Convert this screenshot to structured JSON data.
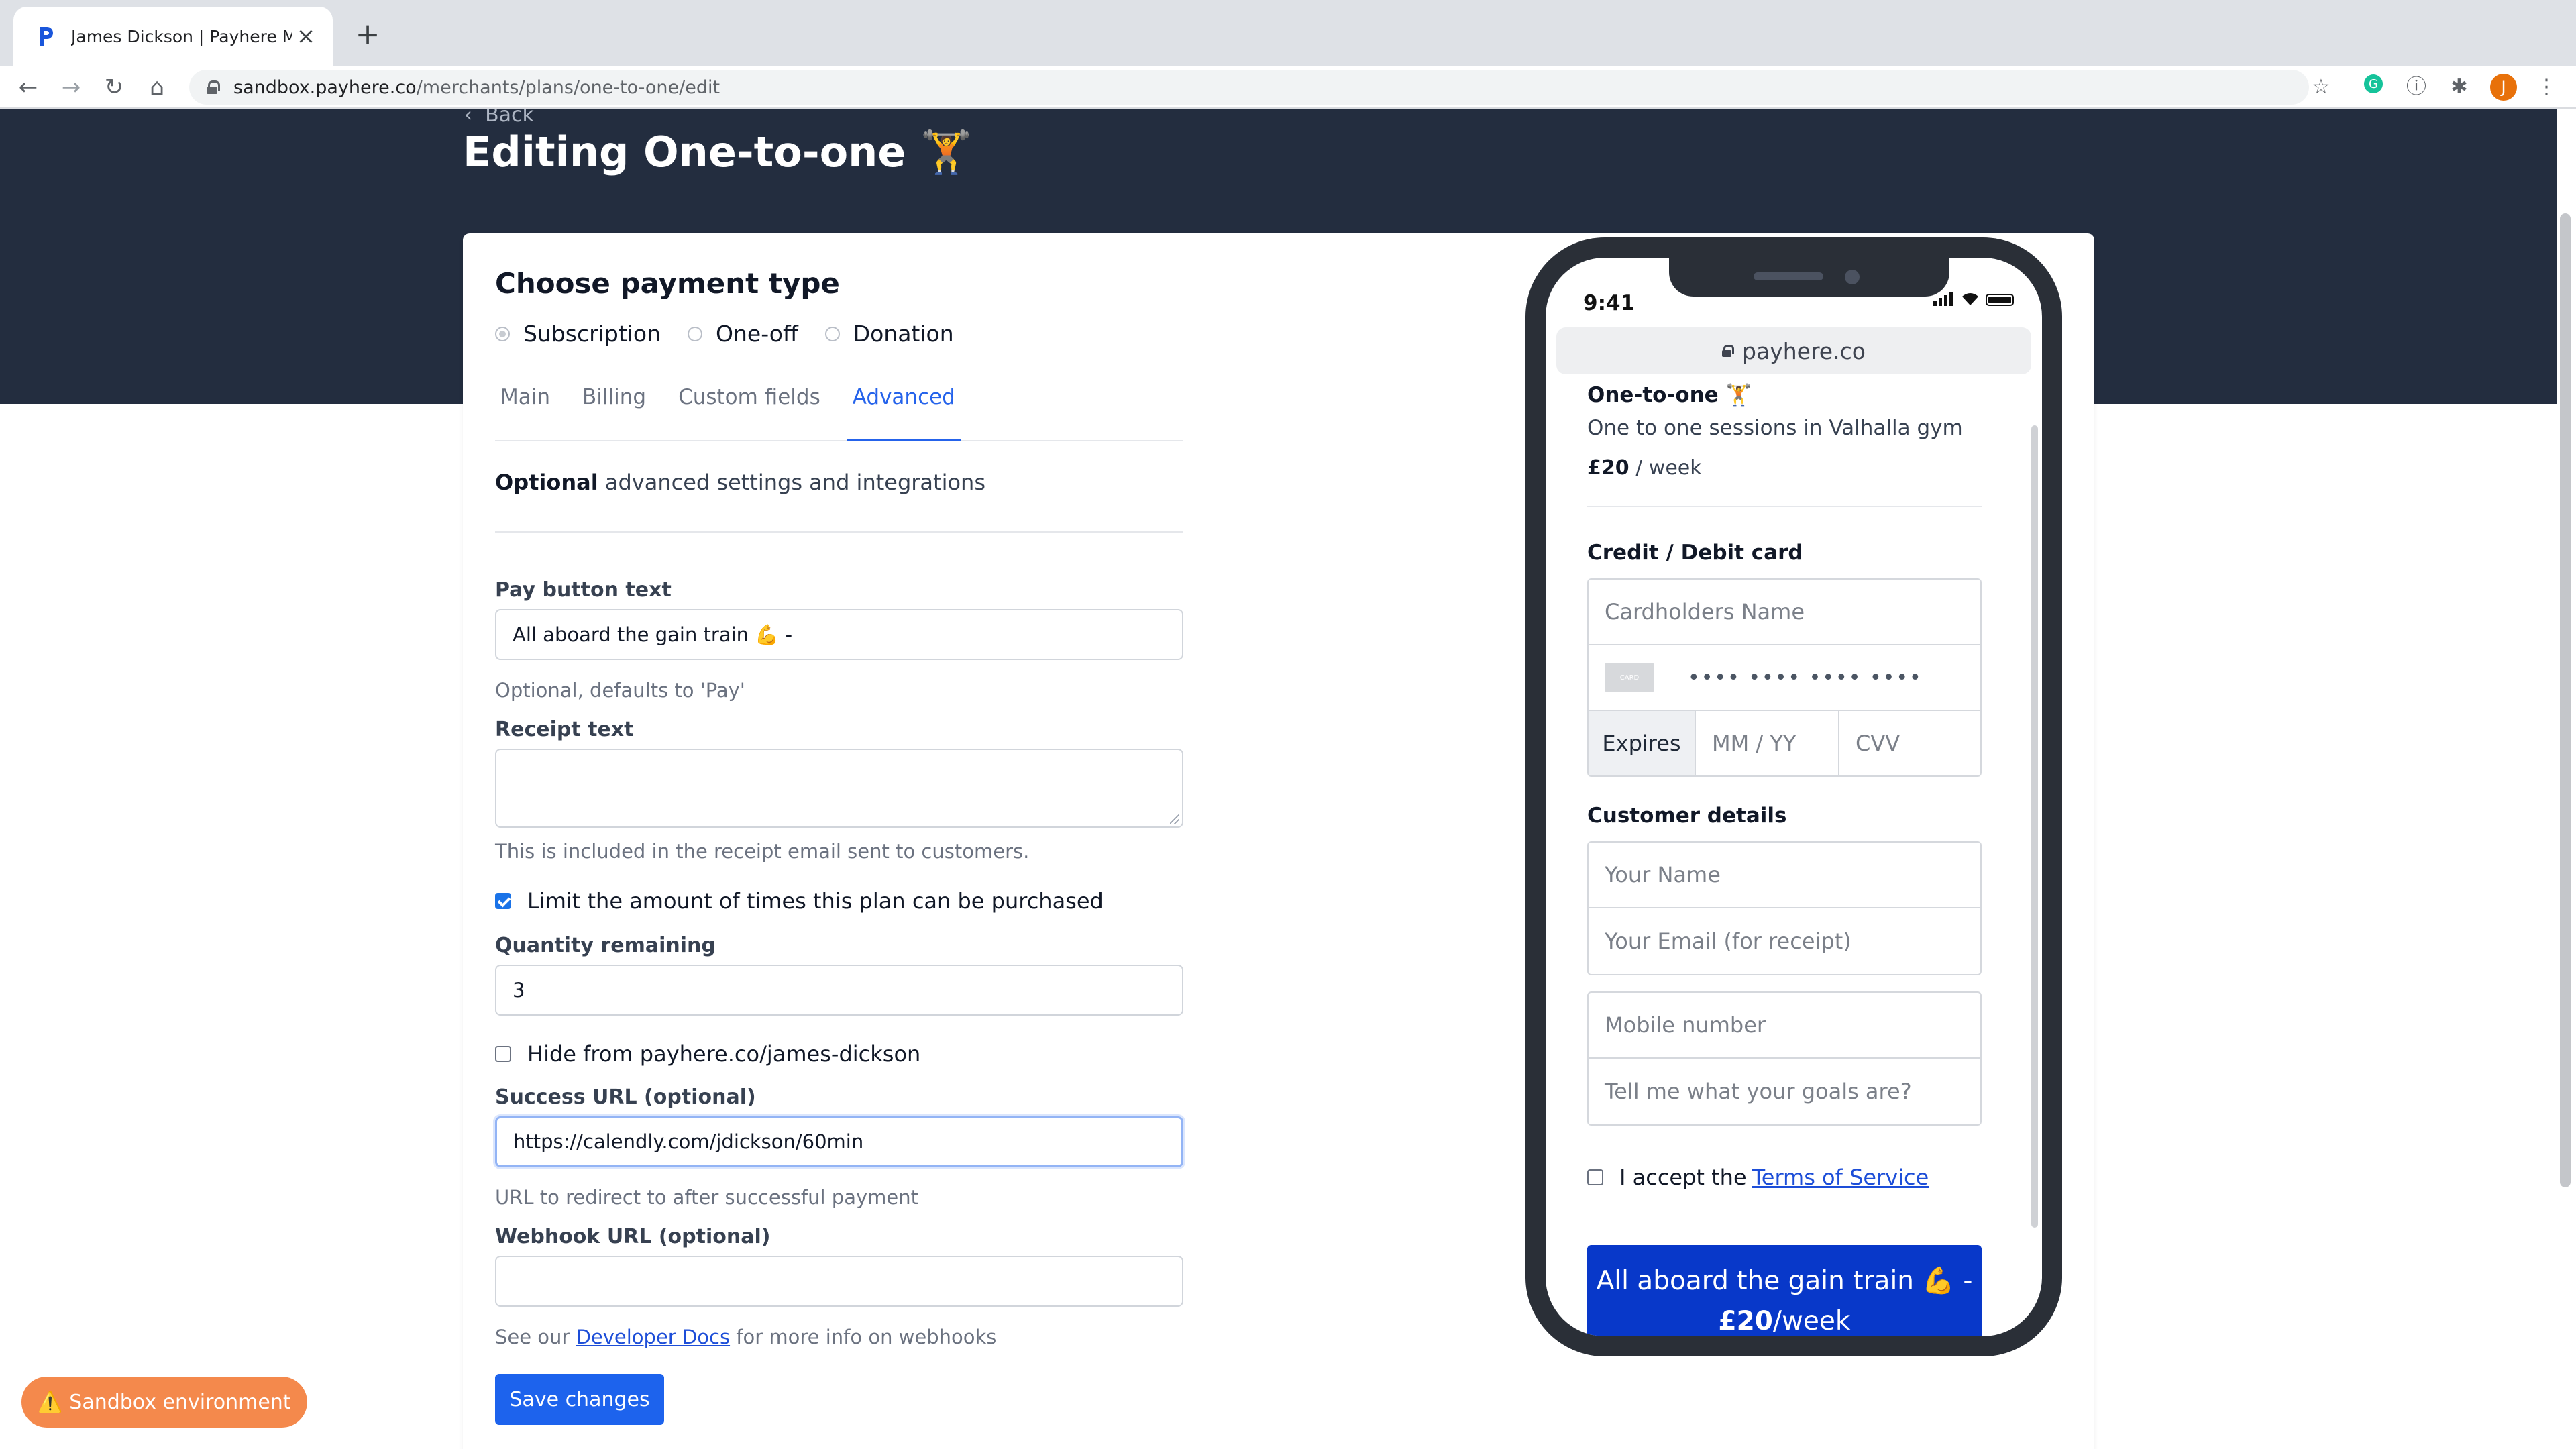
{
  "browser": {
    "tab_title": "James Dickson | Payhere Merc",
    "tab_close": "×",
    "new_tab": "+",
    "url_host": "sandbox.payhere.co",
    "url_path": "/merchants/plans/one-to-one/edit",
    "avatar_letter": "J",
    "favicon_color": "#1a56db"
  },
  "header": {
    "back_label": "Back",
    "title": "Editing One-to-one 🏋"
  },
  "form": {
    "section_title": "Choose payment type",
    "payment_types": [
      "Subscription",
      "One-off",
      "Donation"
    ],
    "selected_payment_type": "Subscription",
    "tabs": [
      "Main",
      "Billing",
      "Custom fields",
      "Advanced"
    ],
    "active_tab": "Advanced",
    "intro_bold": "Optional",
    "intro_rest": " advanced settings and integrations",
    "pay_button_label": "Pay button text",
    "pay_button_value": "All aboard the gain train 💪 -",
    "pay_button_help": "Optional, defaults to 'Pay'",
    "receipt_label": "Receipt text",
    "receipt_value": "",
    "receipt_help": "This is included in the receipt email sent to customers.",
    "limit_label": "Limit the amount of times this plan can be purchased",
    "limit_checked": true,
    "quantity_label": "Quantity remaining",
    "quantity_value": "3",
    "hide_label": "Hide from payhere.co/james-dickson",
    "hide_checked": false,
    "success_url_label": "Success URL (optional)",
    "success_url_value": "https://calendly.com/jdickson/60min",
    "success_url_help": "URL to redirect to after successful payment",
    "webhook_label": "Webhook URL (optional)",
    "webhook_value": "",
    "webhook_help_prefix": "See our ",
    "webhook_help_link": "Developer Docs",
    "webhook_help_suffix": " for more info on webhooks",
    "save_label": "Save changes",
    "accent_color": "#2563eb"
  },
  "preview": {
    "status_time": "9:41",
    "address": "payhere.co",
    "plan_name": "One-to-one 🏋",
    "plan_description": "One to one sessions in Valhalla gym",
    "price_amount": "£20",
    "price_period": " / week",
    "card_heading": "Credit / Debit card",
    "cardholder_placeholder": "Cardholders Name",
    "card_chip_text": "CARD",
    "card_number_placeholder": "•••• •••• •••• ••••",
    "expires_label": "Expires",
    "expiry_placeholder": "MM / YY",
    "cvv_placeholder": "CVV",
    "customer_heading": "Customer details",
    "name_placeholder": "Your Name",
    "email_placeholder": "Your Email (for receipt)",
    "mobile_placeholder": "Mobile number",
    "goals_placeholder": "Tell me what your goals are?",
    "terms_prefix": "I accept the",
    "terms_link": "Terms of Service",
    "pay_line1": "All aboard the gain train 💪 -",
    "pay_amount": "£20",
    "pay_period": "/week",
    "pay_color": "#0838c9"
  },
  "sandbox_badge": "⚠️ Sandbox environment"
}
